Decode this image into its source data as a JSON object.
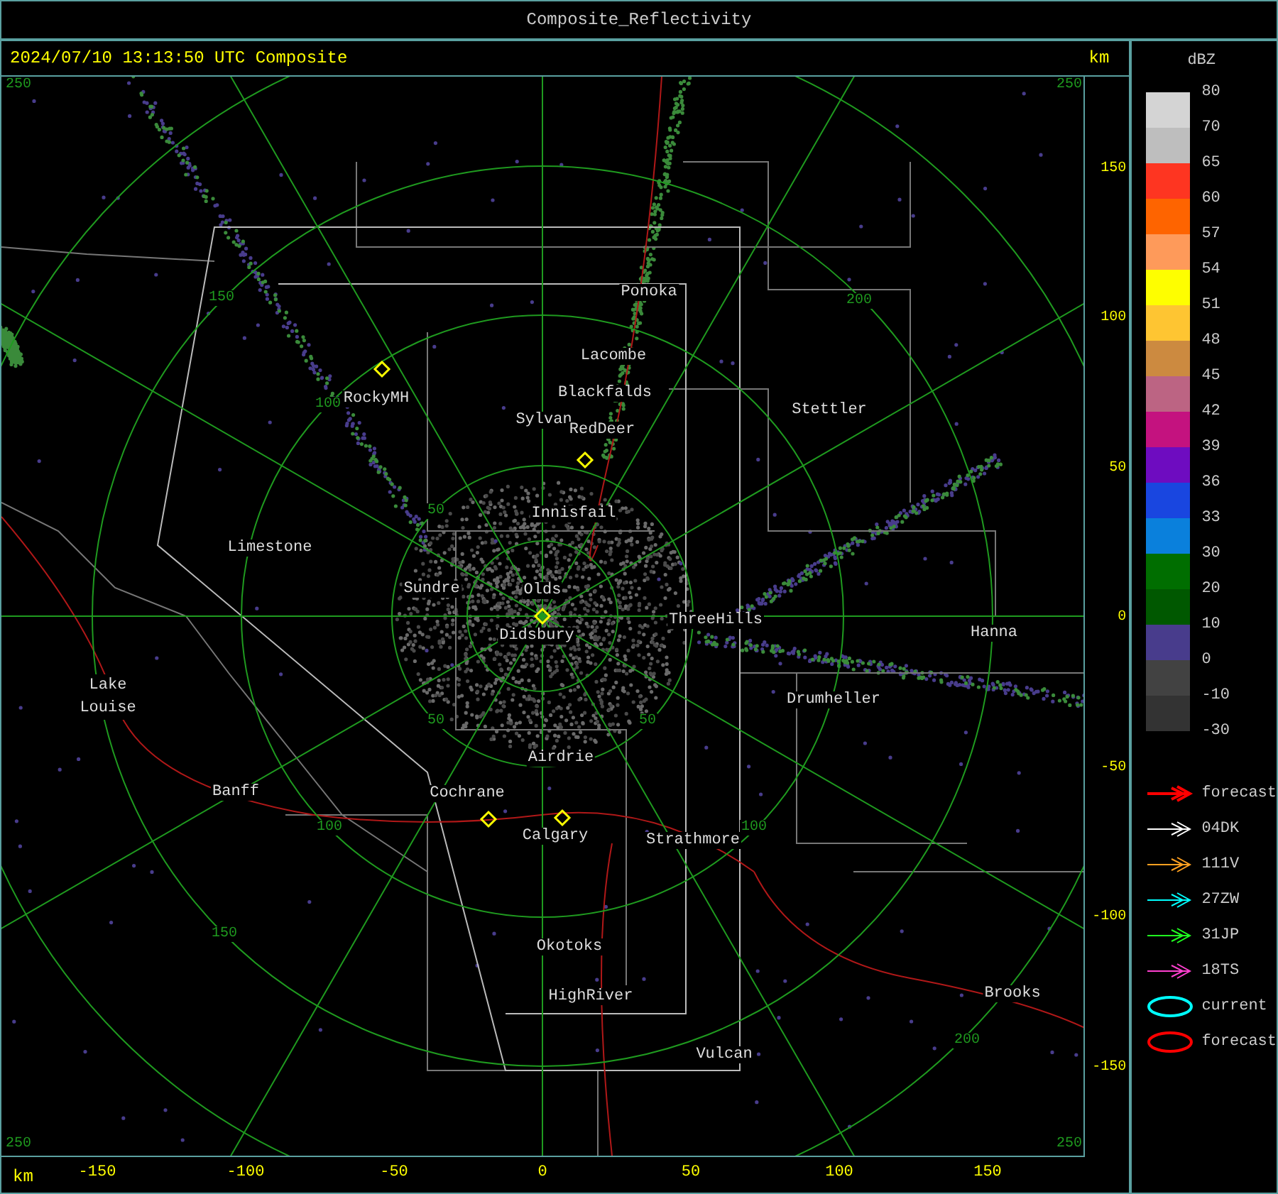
{
  "window": {
    "title": "Composite_Reflectivity"
  },
  "header": {
    "timestamp": "2024/07/10 13:13:50 UTC Composite",
    "unit": "km"
  },
  "map": {
    "places": [
      "Ponoka",
      "Lacombe",
      "Blackfalds",
      "Sylvan",
      "RedDeer",
      "RockyMH",
      "Stettler",
      "Innisfail",
      "Limestone",
      "Sundre",
      "Olds",
      "Didsbury",
      "ThreeHills",
      "Hanna",
      "Lake Louise",
      "Drumheller",
      "Airdrie",
      "Banff",
      "Cochrane",
      "Calgary",
      "Strathmore",
      "Okotoks",
      "HighRiver",
      "Brooks",
      "Vulcan"
    ],
    "range_labels": [
      "150",
      "100",
      "50",
      "50",
      "100",
      "150",
      "50",
      "100",
      "200",
      "200"
    ],
    "corner_labels": [
      "250",
      "250",
      "250",
      "250"
    ]
  },
  "x_axis": {
    "unit": "km",
    "ticks": [
      "-150",
      "-100",
      "-50",
      "0",
      "50",
      "100",
      "150"
    ]
  },
  "y_axis": {
    "ticks": [
      "150",
      "100",
      "50",
      "0",
      "-50",
      "-100",
      "-150"
    ]
  },
  "legend": {
    "title": "dBZ",
    "bins": [
      {
        "label": "80",
        "color": "#d4d4d4"
      },
      {
        "label": "70",
        "color": "#bebebe"
      },
      {
        "label": "65",
        "color": "#fe3521"
      },
      {
        "label": "60",
        "color": "#fe6400"
      },
      {
        "label": "57",
        "color": "#fe9a5a"
      },
      {
        "label": "54",
        "color": "#fefe00"
      },
      {
        "label": "51",
        "color": "#fec532"
      },
      {
        "label": "48",
        "color": "#cc8a40"
      },
      {
        "label": "45",
        "color": "#bc6483"
      },
      {
        "label": "42",
        "color": "#c4127f"
      },
      {
        "label": "39",
        "color": "#6e0cc0"
      },
      {
        "label": "36",
        "color": "#1946e0"
      },
      {
        "label": "33",
        "color": "#0a80dc"
      },
      {
        "label": "30",
        "color": "#006e00"
      },
      {
        "label": "20",
        "color": "#005800"
      },
      {
        "label": "10",
        "color": "#483c8c"
      },
      {
        "label": "0",
        "color": "#424242"
      },
      {
        "label": "-10",
        "color": "#333333"
      }
    ],
    "last_label": "-30",
    "tracks": [
      {
        "kind": "arrow",
        "color": "#ff0000",
        "label": "forecast"
      },
      {
        "kind": "arrow",
        "color": "#ffffff",
        "label": "04DK"
      },
      {
        "kind": "arrow",
        "color": "#ffa020",
        "label": "111V"
      },
      {
        "kind": "arrow",
        "color": "#00ffff",
        "label": "27ZW"
      },
      {
        "kind": "arrow",
        "color": "#20ff20",
        "label": "31JP"
      },
      {
        "kind": "arrow",
        "color": "#ff40d0",
        "label": "18TS"
      },
      {
        "kind": "ellipse",
        "color": "#00ffff",
        "label": "current"
      },
      {
        "kind": "ellipse",
        "color": "#ff0000",
        "label": "forecast"
      }
    ]
  }
}
